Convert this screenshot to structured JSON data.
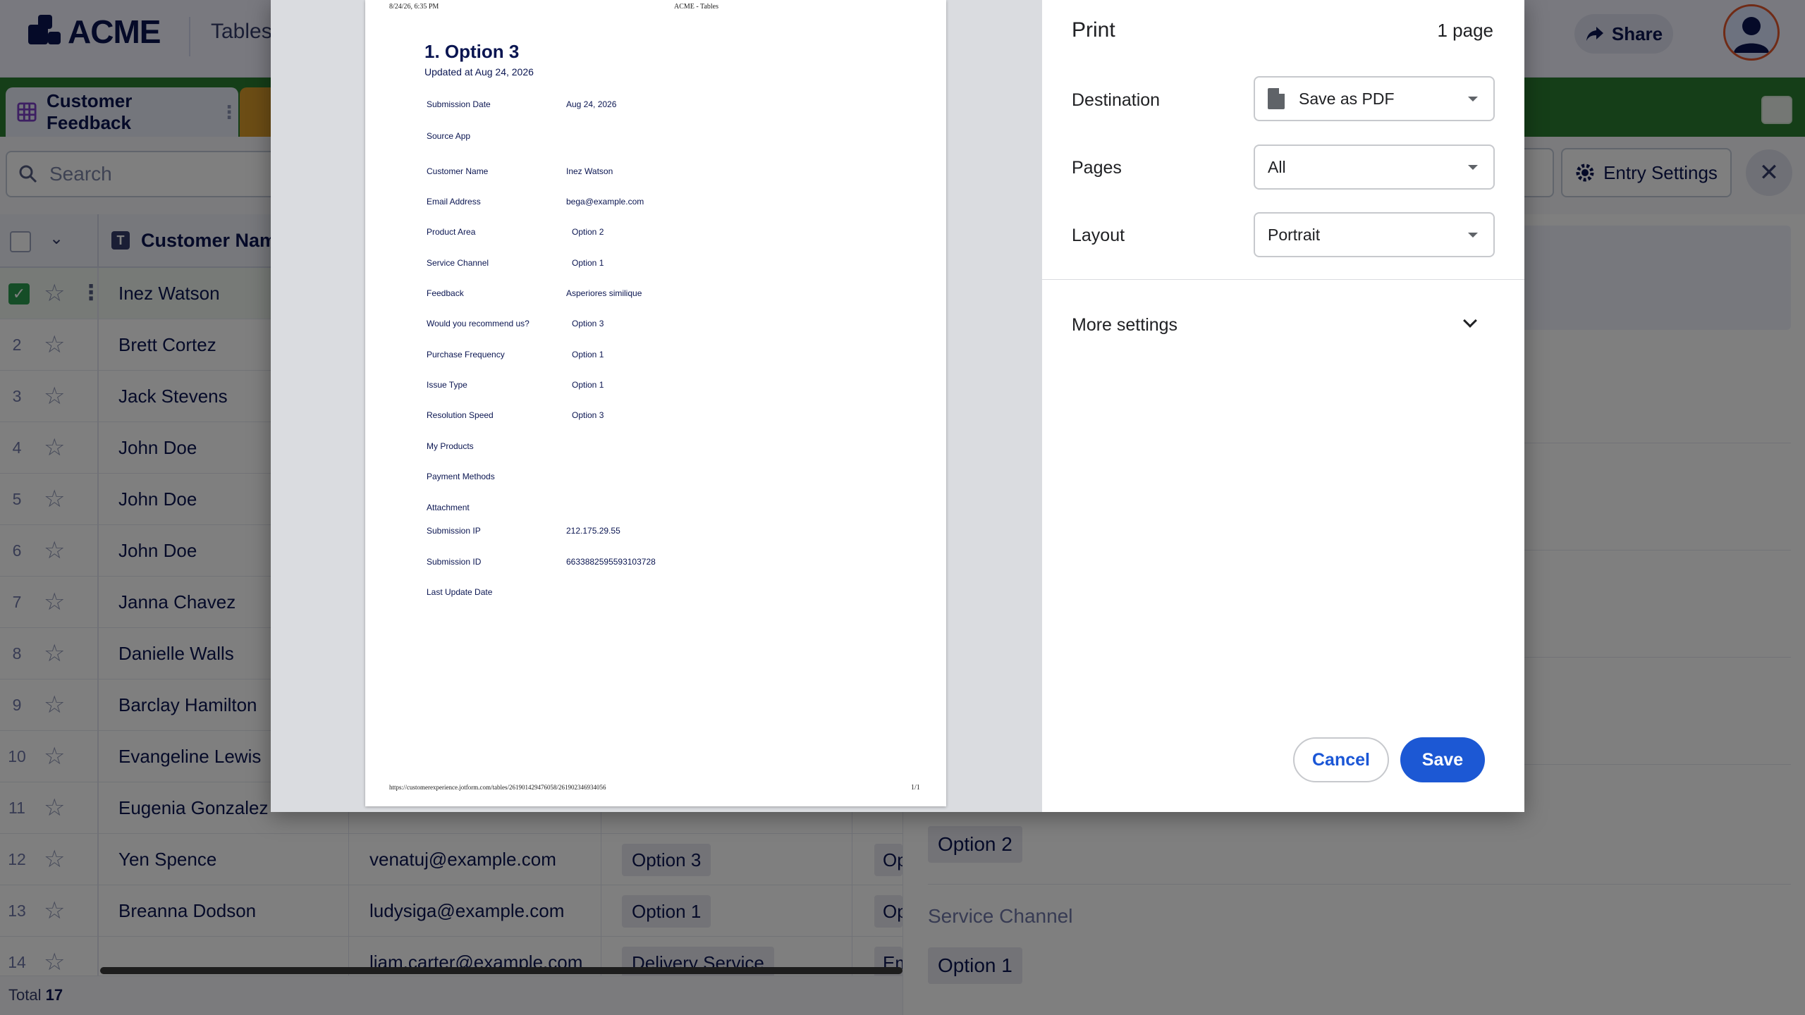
{
  "app": {
    "brand": "ACME",
    "app_name": "Tables",
    "share_label": "Share",
    "colors": {
      "tabbar": "#2b7d30",
      "primary": "#1c58d4",
      "navy": "#0a1551"
    }
  },
  "tabs": {
    "active_label": "Customer Feedback"
  },
  "toolbar": {
    "search_placeholder": "Search",
    "entry_settings_label": "Entry Settings"
  },
  "grid": {
    "header": {
      "column_label": "Customer Name"
    },
    "rows": [
      {
        "num": "",
        "name": "Inez Watson",
        "email": "",
        "chip": "",
        "chip2": "",
        "selected": true
      },
      {
        "num": "2",
        "name": "Brett Cortez",
        "email": "",
        "chip": "",
        "chip2": ""
      },
      {
        "num": "3",
        "name": "Jack Stevens",
        "email": "",
        "chip": "",
        "chip2": ""
      },
      {
        "num": "4",
        "name": "John Doe",
        "email": "",
        "chip": "",
        "chip2": ""
      },
      {
        "num": "5",
        "name": "John Doe",
        "email": "",
        "chip": "",
        "chip2": ""
      },
      {
        "num": "6",
        "name": "John Doe",
        "email": "",
        "chip": "",
        "chip2": ""
      },
      {
        "num": "7",
        "name": "Janna Chavez",
        "email": "",
        "chip": "",
        "chip2": ""
      },
      {
        "num": "8",
        "name": "Danielle Walls",
        "email": "",
        "chip": "",
        "chip2": ""
      },
      {
        "num": "9",
        "name": "Barclay Hamilton",
        "email": "",
        "chip": "",
        "chip2": ""
      },
      {
        "num": "10",
        "name": "Evangeline Lewis",
        "email": "",
        "chip": "",
        "chip2": ""
      },
      {
        "num": "11",
        "name": "Eugenia Gonzalez",
        "email": "",
        "chip": "",
        "chip2": ""
      },
      {
        "num": "12",
        "name": "Yen Spence",
        "email": "venatuj@example.com",
        "chip": "Option 3",
        "chip2": "Op"
      },
      {
        "num": "13",
        "name": "Breanna Dodson",
        "email": "ludysiga@example.com",
        "chip": "Option 1",
        "chip2": "Op"
      },
      {
        "num": "14",
        "name": "",
        "email": "liam.carter@example.com",
        "chip": "Delivery Service",
        "chip2": "Em"
      }
    ],
    "total_label": "Total",
    "total_value": "17"
  },
  "right_panel": {
    "product_area_chip": "Option 2",
    "service_channel_label": "Service Channel",
    "service_channel_chip": "Option 1"
  },
  "print": {
    "title": "Print",
    "page_count": "1 page",
    "destination_label": "Destination",
    "destination_value": "Save as PDF",
    "pages_label": "Pages",
    "pages_value": "All",
    "layout_label": "Layout",
    "layout_value": "Portrait",
    "more_settings_label": "More settings",
    "cancel_label": "Cancel",
    "save_label": "Save",
    "preview": {
      "header_left": "8/24/26, 6:35 PM",
      "header_center": "ACME - Tables",
      "title": "1. Option 3",
      "updated": "Updated at Aug 24, 2026",
      "fields": [
        {
          "label": "Submission Date",
          "value": "Aug 24, 2026"
        },
        {
          "label": "Source App",
          "value": ""
        },
        {
          "label": "Customer Name",
          "value": "Inez Watson"
        },
        {
          "label": "Email Address",
          "value": "bega@example.com"
        },
        {
          "label": "Product Area",
          "value": "Option 2"
        },
        {
          "label": "Service Channel",
          "value": "Option 1"
        },
        {
          "label": "Feedback",
          "value": "Asperiores similique"
        },
        {
          "label": "Would you recommend us?",
          "value": "Option 3"
        },
        {
          "label": "Purchase Frequency",
          "value": "Option 1"
        },
        {
          "label": "Issue Type",
          "value": "Option 1"
        },
        {
          "label": "Resolution Speed",
          "value": "Option 3"
        },
        {
          "label": "My Products",
          "value": ""
        },
        {
          "label": "Payment Methods",
          "value": ""
        },
        {
          "label": "Attachment",
          "value": ""
        },
        {
          "label": "Submission IP",
          "value": "212.175.29.55"
        },
        {
          "label": "Submission ID",
          "value": "6633882595593103728"
        },
        {
          "label": "Last Update Date",
          "value": ""
        }
      ],
      "footer_url": "https://customerexperience.jotform.com/tables/261901429476058/261902346934056",
      "footer_page": "1/1"
    }
  }
}
